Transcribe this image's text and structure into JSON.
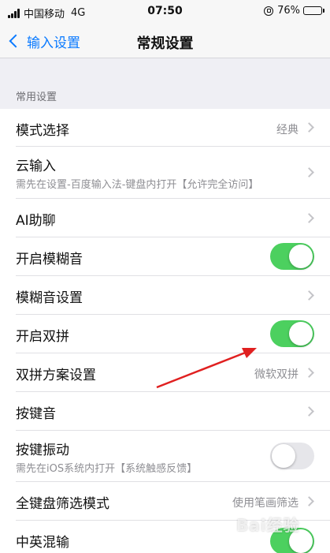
{
  "status_bar": {
    "carrier": "中国移动",
    "network": "4G",
    "time": "07:50",
    "battery": "76%",
    "battery_level": 0.76
  },
  "nav": {
    "back_label": "输入设置",
    "title": "常规设置"
  },
  "section": {
    "header": "常用设置"
  },
  "rows": {
    "mode": {
      "title": "模式选择",
      "value": "经典"
    },
    "cloud": {
      "title": "云输入",
      "subtitle": "需先在设置-百度输入法-键盘内打开【允许完全访问】"
    },
    "ai": {
      "title": "AI助聊"
    },
    "fuzzy": {
      "title": "开启模糊音",
      "on": true
    },
    "fuzzy_settings": {
      "title": "模糊音设置"
    },
    "shuangpin": {
      "title": "开启双拼",
      "on": true
    },
    "shuangpin_scheme": {
      "title": "双拼方案设置",
      "value": "微软双拼"
    },
    "key_sound": {
      "title": "按键音"
    },
    "key_vibration": {
      "title": "按键振动",
      "subtitle": "需先在iOS系统内打开【系统触感反馈】",
      "on": false
    },
    "keyboard_filter": {
      "title": "全键盘筛选模式",
      "value": "使用笔画筛选"
    },
    "mixed": {
      "title": "中英混输",
      "on": true
    }
  },
  "annotation": {
    "color": "#e02020"
  },
  "watermark": "Bai经验"
}
